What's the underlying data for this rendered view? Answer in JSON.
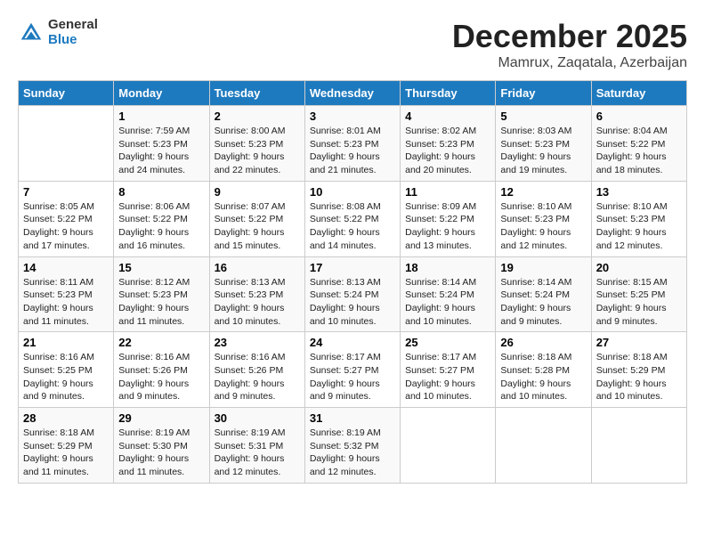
{
  "logo": {
    "line1": "General",
    "line2": "Blue"
  },
  "header": {
    "month": "December 2025",
    "location": "Mamrux, Zaqatala, Azerbaijan"
  },
  "columns": [
    "Sunday",
    "Monday",
    "Tuesday",
    "Wednesday",
    "Thursday",
    "Friday",
    "Saturday"
  ],
  "weeks": [
    [
      {
        "day": "",
        "info": ""
      },
      {
        "day": "1",
        "info": "Sunrise: 7:59 AM\nSunset: 5:23 PM\nDaylight: 9 hours\nand 24 minutes."
      },
      {
        "day": "2",
        "info": "Sunrise: 8:00 AM\nSunset: 5:23 PM\nDaylight: 9 hours\nand 22 minutes."
      },
      {
        "day": "3",
        "info": "Sunrise: 8:01 AM\nSunset: 5:23 PM\nDaylight: 9 hours\nand 21 minutes."
      },
      {
        "day": "4",
        "info": "Sunrise: 8:02 AM\nSunset: 5:23 PM\nDaylight: 9 hours\nand 20 minutes."
      },
      {
        "day": "5",
        "info": "Sunrise: 8:03 AM\nSunset: 5:23 PM\nDaylight: 9 hours\nand 19 minutes."
      },
      {
        "day": "6",
        "info": "Sunrise: 8:04 AM\nSunset: 5:22 PM\nDaylight: 9 hours\nand 18 minutes."
      }
    ],
    [
      {
        "day": "7",
        "info": "Sunrise: 8:05 AM\nSunset: 5:22 PM\nDaylight: 9 hours\nand 17 minutes."
      },
      {
        "day": "8",
        "info": "Sunrise: 8:06 AM\nSunset: 5:22 PM\nDaylight: 9 hours\nand 16 minutes."
      },
      {
        "day": "9",
        "info": "Sunrise: 8:07 AM\nSunset: 5:22 PM\nDaylight: 9 hours\nand 15 minutes."
      },
      {
        "day": "10",
        "info": "Sunrise: 8:08 AM\nSunset: 5:22 PM\nDaylight: 9 hours\nand 14 minutes."
      },
      {
        "day": "11",
        "info": "Sunrise: 8:09 AM\nSunset: 5:22 PM\nDaylight: 9 hours\nand 13 minutes."
      },
      {
        "day": "12",
        "info": "Sunrise: 8:10 AM\nSunset: 5:23 PM\nDaylight: 9 hours\nand 12 minutes."
      },
      {
        "day": "13",
        "info": "Sunrise: 8:10 AM\nSunset: 5:23 PM\nDaylight: 9 hours\nand 12 minutes."
      }
    ],
    [
      {
        "day": "14",
        "info": "Sunrise: 8:11 AM\nSunset: 5:23 PM\nDaylight: 9 hours\nand 11 minutes."
      },
      {
        "day": "15",
        "info": "Sunrise: 8:12 AM\nSunset: 5:23 PM\nDaylight: 9 hours\nand 11 minutes."
      },
      {
        "day": "16",
        "info": "Sunrise: 8:13 AM\nSunset: 5:23 PM\nDaylight: 9 hours\nand 10 minutes."
      },
      {
        "day": "17",
        "info": "Sunrise: 8:13 AM\nSunset: 5:24 PM\nDaylight: 9 hours\nand 10 minutes."
      },
      {
        "day": "18",
        "info": "Sunrise: 8:14 AM\nSunset: 5:24 PM\nDaylight: 9 hours\nand 10 minutes."
      },
      {
        "day": "19",
        "info": "Sunrise: 8:14 AM\nSunset: 5:24 PM\nDaylight: 9 hours\nand 9 minutes."
      },
      {
        "day": "20",
        "info": "Sunrise: 8:15 AM\nSunset: 5:25 PM\nDaylight: 9 hours\nand 9 minutes."
      }
    ],
    [
      {
        "day": "21",
        "info": "Sunrise: 8:16 AM\nSunset: 5:25 PM\nDaylight: 9 hours\nand 9 minutes."
      },
      {
        "day": "22",
        "info": "Sunrise: 8:16 AM\nSunset: 5:26 PM\nDaylight: 9 hours\nand 9 minutes."
      },
      {
        "day": "23",
        "info": "Sunrise: 8:16 AM\nSunset: 5:26 PM\nDaylight: 9 hours\nand 9 minutes."
      },
      {
        "day": "24",
        "info": "Sunrise: 8:17 AM\nSunset: 5:27 PM\nDaylight: 9 hours\nand 9 minutes."
      },
      {
        "day": "25",
        "info": "Sunrise: 8:17 AM\nSunset: 5:27 PM\nDaylight: 9 hours\nand 10 minutes."
      },
      {
        "day": "26",
        "info": "Sunrise: 8:18 AM\nSunset: 5:28 PM\nDaylight: 9 hours\nand 10 minutes."
      },
      {
        "day": "27",
        "info": "Sunrise: 8:18 AM\nSunset: 5:29 PM\nDaylight: 9 hours\nand 10 minutes."
      }
    ],
    [
      {
        "day": "28",
        "info": "Sunrise: 8:18 AM\nSunset: 5:29 PM\nDaylight: 9 hours\nand 11 minutes."
      },
      {
        "day": "29",
        "info": "Sunrise: 8:19 AM\nSunset: 5:30 PM\nDaylight: 9 hours\nand 11 minutes."
      },
      {
        "day": "30",
        "info": "Sunrise: 8:19 AM\nSunset: 5:31 PM\nDaylight: 9 hours\nand 12 minutes."
      },
      {
        "day": "31",
        "info": "Sunrise: 8:19 AM\nSunset: 5:32 PM\nDaylight: 9 hours\nand 12 minutes."
      },
      {
        "day": "",
        "info": ""
      },
      {
        "day": "",
        "info": ""
      },
      {
        "day": "",
        "info": ""
      }
    ]
  ]
}
